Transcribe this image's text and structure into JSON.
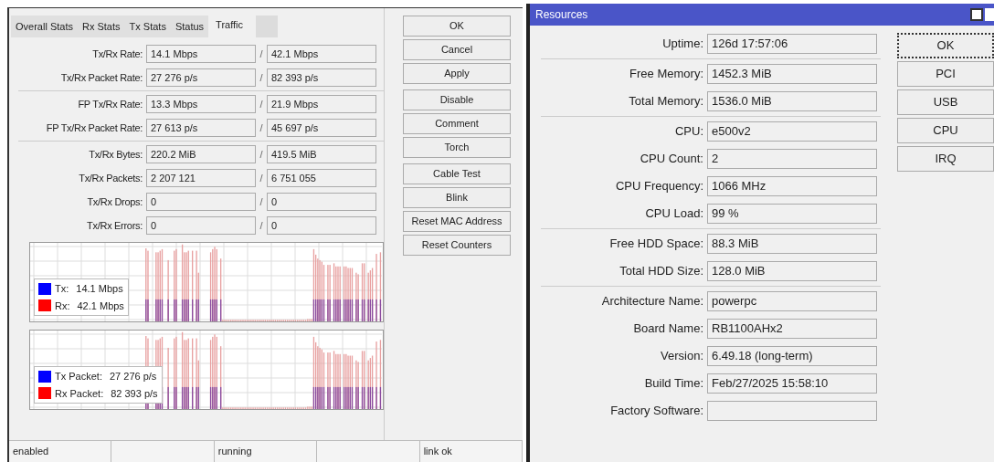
{
  "interface_window": {
    "tabs": [
      {
        "label": "Overall Stats",
        "selected": false
      },
      {
        "label": "Rx Stats",
        "selected": false
      },
      {
        "label": "Tx Stats",
        "selected": false
      },
      {
        "label": "Status",
        "selected": false
      },
      {
        "label": "Traffic",
        "selected": true
      }
    ],
    "field_groups": [
      [
        {
          "label": "Tx/Rx Rate:",
          "tx": "14.1 Mbps",
          "rx": "42.1 Mbps"
        },
        {
          "label": "Tx/Rx Packet Rate:",
          "tx": "27 276 p/s",
          "rx": "82 393 p/s"
        }
      ],
      [
        {
          "label": "FP Tx/Rx Rate:",
          "tx": "13.3 Mbps",
          "rx": "21.9 Mbps"
        },
        {
          "label": "FP Tx/Rx Packet Rate:",
          "tx": "27 613 p/s",
          "rx": "45 697 p/s"
        }
      ],
      [
        {
          "label": "Tx/Rx Bytes:",
          "tx": "220.2 MiB",
          "rx": "419.5 MiB"
        },
        {
          "label": "Tx/Rx Packets:",
          "tx": "2 207 121",
          "rx": "6 751 055"
        },
        {
          "label": "Tx/Rx Drops:",
          "tx": "0",
          "rx": "0"
        },
        {
          "label": "Tx/Rx Errors:",
          "tx": "0",
          "rx": "0"
        }
      ]
    ],
    "separator": "/",
    "graphs": [
      {
        "legend": [
          {
            "label": "Tx:",
            "value": "14.1 Mbps",
            "color": "#0000ff"
          },
          {
            "label": "Rx:",
            "value": "42.1 Mbps",
            "color": "#ff0000"
          }
        ]
      },
      {
        "legend": [
          {
            "label": "Tx Packet:",
            "value": "27 276 p/s",
            "color": "#0000ff"
          },
          {
            "label": "Rx Packet:",
            "value": "82 393 p/s",
            "color": "#ff0000"
          }
        ]
      }
    ],
    "button_groups": [
      [
        "OK",
        "Cancel",
        "Apply"
      ],
      [
        "Disable",
        "Comment",
        "Torch"
      ],
      [
        "Cable Test",
        "Blink",
        "Reset MAC Address",
        "Reset Counters"
      ]
    ],
    "status_bar": [
      {
        "kind": "text",
        "text": "enabled"
      },
      {
        "kind": "blank"
      },
      {
        "kind": "text",
        "text": "running"
      },
      {
        "kind": "blank"
      },
      {
        "kind": "text",
        "text": "link ok"
      }
    ]
  },
  "resources_window": {
    "title": "Resources",
    "field_groups": [
      [
        {
          "label": "Uptime:",
          "value": "126d 17:57:06"
        }
      ],
      [
        {
          "label": "Free Memory:",
          "value": "1452.3 MiB"
        },
        {
          "label": "Total Memory:",
          "value": "1536.0 MiB"
        }
      ],
      [
        {
          "label": "CPU:",
          "value": "e500v2"
        },
        {
          "label": "CPU Count:",
          "value": "2"
        },
        {
          "label": "CPU Frequency:",
          "value": "1066 MHz"
        },
        {
          "label": "CPU Load:",
          "value": "99 %"
        }
      ],
      [
        {
          "label": "Free HDD Space:",
          "value": "88.3 MiB"
        },
        {
          "label": "Total HDD Size:",
          "value": "128.0 MiB"
        }
      ],
      [
        {
          "label": "Architecture Name:",
          "value": "powerpc"
        },
        {
          "label": "Board Name:",
          "value": "RB1100AHx2"
        },
        {
          "label": "Version:",
          "value": "6.49.18 (long-term)"
        },
        {
          "label": "Build Time:",
          "value": "Feb/27/2025 15:58:10"
        },
        {
          "label": "Factory Software:"
        }
      ]
    ],
    "buttons": [
      {
        "label": "OK",
        "focused": true
      },
      {
        "label": "PCI",
        "focused": false
      },
      {
        "label": "USB",
        "focused": false
      },
      {
        "label": "CPU",
        "focused": false
      },
      {
        "label": "IRQ",
        "focused": false
      }
    ]
  }
}
